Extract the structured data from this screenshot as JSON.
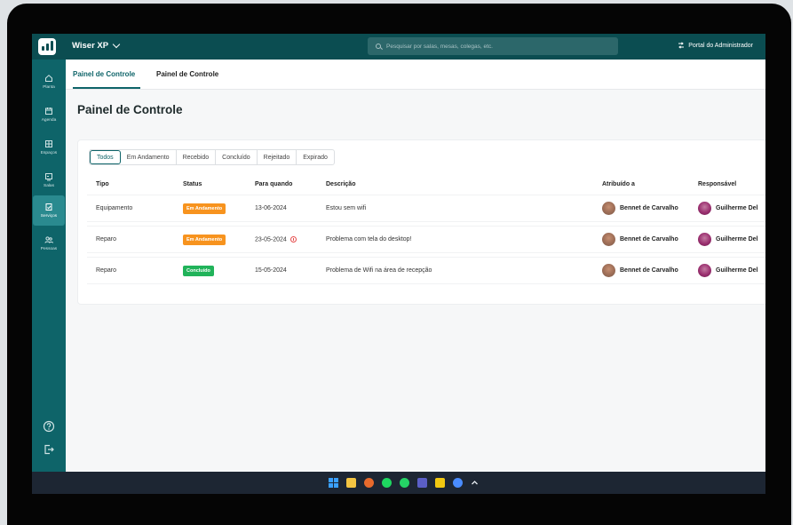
{
  "topbar": {
    "app_name": "Wiser XP",
    "search_placeholder": "Pesquisar por salas, mesas, colegas, etc.",
    "portal_label": "Portal do Administrador"
  },
  "sidebar": {
    "items": [
      {
        "label": "Planta",
        "icon": "home-icon"
      },
      {
        "label": "Agenda",
        "icon": "calendar-icon"
      },
      {
        "label": "Espaços",
        "icon": "grid-icon"
      },
      {
        "label": "Salas",
        "icon": "screen-icon"
      },
      {
        "label": "Serviços",
        "icon": "clipboard-icon"
      },
      {
        "label": "Pessoas",
        "icon": "people-icon"
      }
    ],
    "active_index": 4
  },
  "tabs": [
    {
      "label": "Painel de Controle"
    },
    {
      "label": "Painel de Controle"
    }
  ],
  "page_title": "Painel de Controle",
  "filters": [
    "Todos",
    "Em Andamento",
    "Recebido",
    "Concluído",
    "Rejeitado",
    "Expirado"
  ],
  "table": {
    "headers": {
      "tipo": "Tipo",
      "status": "Status",
      "para_quando": "Para quando",
      "descricao": "Descrição",
      "atribuido": "Atribuído a",
      "responsavel": "Responsável"
    },
    "rows": [
      {
        "tipo": "Equipamento",
        "status": "Em Andamento",
        "status_color": "#f7931e",
        "data": "13-06-2024",
        "overdue": false,
        "descricao": "Estou sem wifi",
        "atribuido": "Bennet de Carvalho",
        "responsavel": "Guilherme Del"
      },
      {
        "tipo": "Reparo",
        "status": "Em Andamento",
        "status_color": "#f7931e",
        "data": "23-05-2024",
        "overdue": true,
        "descricao": "Problema com tela do desktop!",
        "atribuido": "Bennet de Carvalho",
        "responsavel": "Guilherme Del"
      },
      {
        "tipo": "Reparo",
        "status": "Concluído",
        "status_color": "#21b35a",
        "data": "15-05-2024",
        "overdue": false,
        "descricao": "Problema de Wifi na área de recepção",
        "atribuido": "Bennet de Carvalho",
        "responsavel": "Guilherme Del"
      }
    ]
  },
  "colors": {
    "brand": "#0b4d51",
    "accent": "#0e6469",
    "in_progress": "#f7931e",
    "done": "#21b35a"
  }
}
